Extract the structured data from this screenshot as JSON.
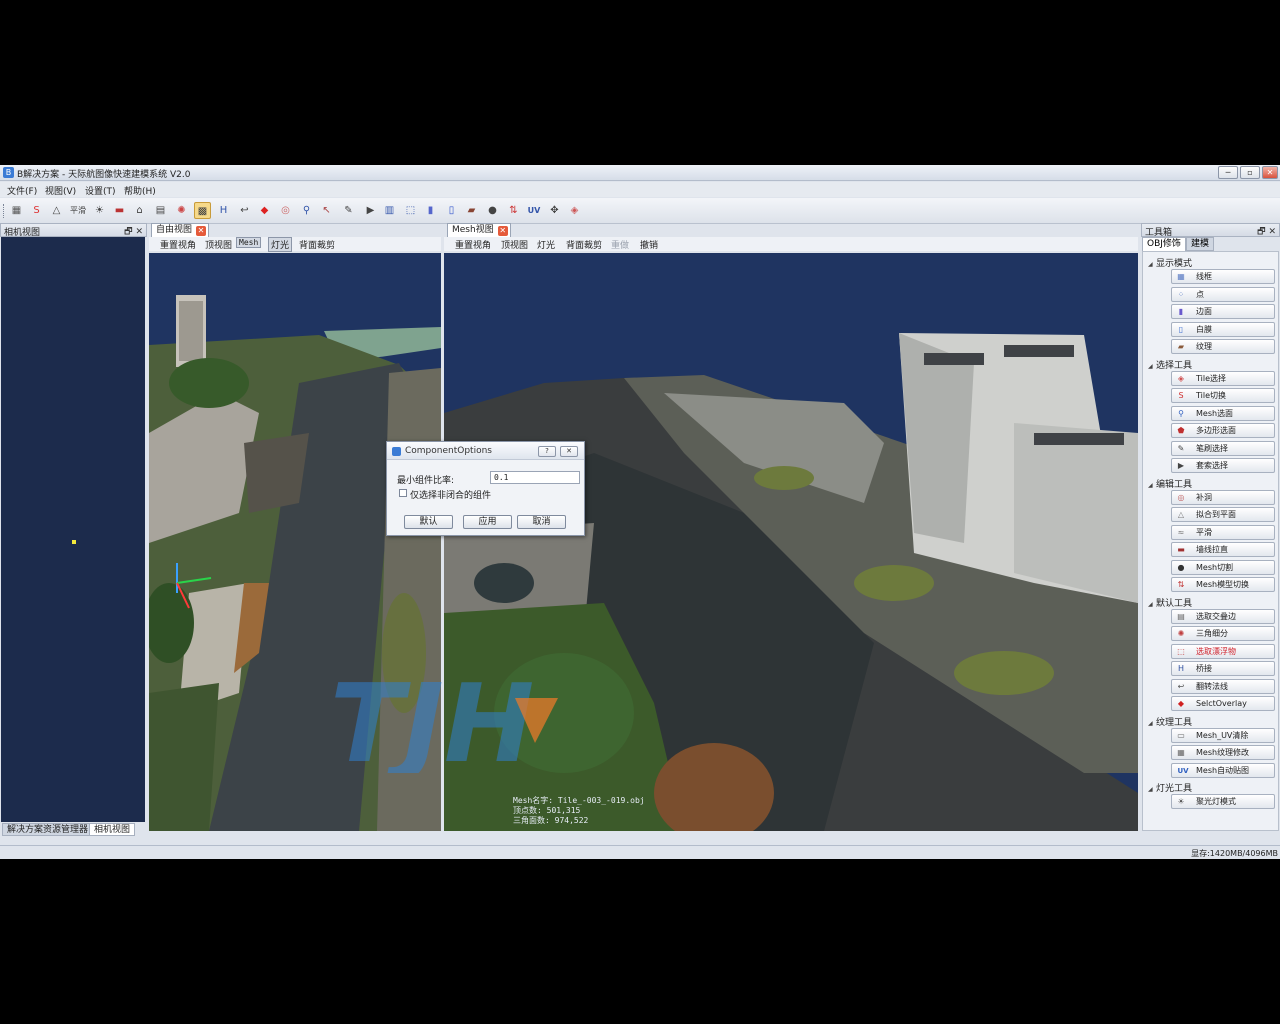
{
  "window": {
    "title": "B解决方案 - 天际航图像快速建模系统 V2.0",
    "app_icon": "app-icon",
    "minimize": "─",
    "maximize": "▫",
    "close": "✕"
  },
  "menu": [
    {
      "label": "文件(F)"
    },
    {
      "label": "视图(V)"
    },
    {
      "label": "设置(T)"
    },
    {
      "label": "帮助(H)"
    }
  ],
  "toolbar": {
    "flatten_label": "平滑",
    "uv_label": "UV"
  },
  "left_panel": {
    "title": "相机视图",
    "float_icon": "🗗",
    "close_icon": "✕",
    "tabs": [
      {
        "label": "解决方案资源管理器"
      },
      {
        "label": "相机视图"
      }
    ]
  },
  "free_view": {
    "tab_label": "自由视图",
    "toolbar": [
      {
        "label": "重置视角"
      },
      {
        "label": "顶视图"
      },
      {
        "label": "Mesh"
      },
      {
        "label": "灯光"
      },
      {
        "label": "背面裁剪"
      }
    ]
  },
  "mesh_view": {
    "tab_label": "Mesh视图",
    "toolbar": [
      {
        "label": "重置视角"
      },
      {
        "label": "顶视图"
      },
      {
        "label": "灯光"
      },
      {
        "label": "背面裁剪"
      },
      {
        "label": "重做"
      },
      {
        "label": "撤销"
      }
    ],
    "info": {
      "line1": "Mesh名字: Tile_-003_-019.obj",
      "line2": "顶点数: 501,315",
      "line3": "三角面数: 974,522"
    },
    "watermark": "TJH"
  },
  "dialog": {
    "title": "ComponentOptions",
    "help_button": "?",
    "close_button": "✕",
    "min_ratio_label": "最小组件比率:",
    "min_ratio_value": "0.1",
    "checkbox_label": "仅选择非闭合的组件",
    "checkbox_checked": false,
    "default_button": "默认",
    "apply_button": "应用",
    "cancel_button": "取消"
  },
  "toolbox": {
    "title": "工具箱",
    "float_icon": "🗗",
    "close_icon": "✕",
    "tabs": [
      {
        "label": "OBJ修饰"
      },
      {
        "label": "建模"
      }
    ],
    "groups": [
      {
        "label": "显示模式",
        "items": [
          {
            "label": "线框",
            "icon": "wireframe-icon"
          },
          {
            "label": "点",
            "icon": "points-icon"
          },
          {
            "label": "边面",
            "icon": "edge-face-icon"
          },
          {
            "label": "白膜",
            "icon": "white-model-icon"
          },
          {
            "label": "纹理",
            "icon": "texture-icon"
          }
        ]
      },
      {
        "label": "选择工具",
        "items": [
          {
            "label": "Tile选择",
            "icon": "tile-select-icon"
          },
          {
            "label": "Tile切换",
            "icon": "tile-switch-icon"
          },
          {
            "label": "Mesh选面",
            "icon": "mesh-select-icon"
          },
          {
            "label": "多边形选面",
            "icon": "polygon-select-icon"
          },
          {
            "label": "笔刷选择",
            "icon": "brush-select-icon"
          },
          {
            "label": "套索选择",
            "icon": "lasso-select-icon"
          }
        ]
      },
      {
        "label": "编辑工具",
        "items": [
          {
            "label": "补洞",
            "icon": "fill-hole-icon"
          },
          {
            "label": "拟合到平面",
            "icon": "fit-plane-icon"
          },
          {
            "label": "平滑",
            "icon": "smooth-icon"
          },
          {
            "label": "墙线拉直",
            "icon": "straighten-icon"
          },
          {
            "label": "Mesh切割",
            "icon": "mesh-cut-icon"
          },
          {
            "label": "Mesh模型切换",
            "icon": "mesh-switch-icon"
          }
        ]
      },
      {
        "label": "默认工具",
        "items": [
          {
            "label": "选取交叠边",
            "icon": "overlap-edge-icon"
          },
          {
            "label": "三角细分",
            "icon": "subdivide-icon"
          },
          {
            "label": "选取漂浮物",
            "icon": "floating-select-icon",
            "highlight": true
          },
          {
            "label": "桥接",
            "icon": "bridge-icon"
          },
          {
            "label": "翻转法线",
            "icon": "flip-normal-icon"
          },
          {
            "label": "SelctOverlay",
            "icon": "select-overlay-icon"
          }
        ]
      },
      {
        "label": "纹理工具",
        "items": [
          {
            "label": "Mesh_UV清除",
            "icon": "uv-clear-icon"
          },
          {
            "label": "Mesh纹理修改",
            "icon": "texture-edit-icon"
          },
          {
            "label": "Mesh自动贴图",
            "icon": "uv-auto-icon"
          }
        ]
      },
      {
        "label": "灯光工具",
        "items": [
          {
            "label": "聚光灯模式",
            "icon": "spotlight-icon"
          }
        ]
      }
    ]
  },
  "status": {
    "memory": "显存:1420MB/4096MB"
  }
}
